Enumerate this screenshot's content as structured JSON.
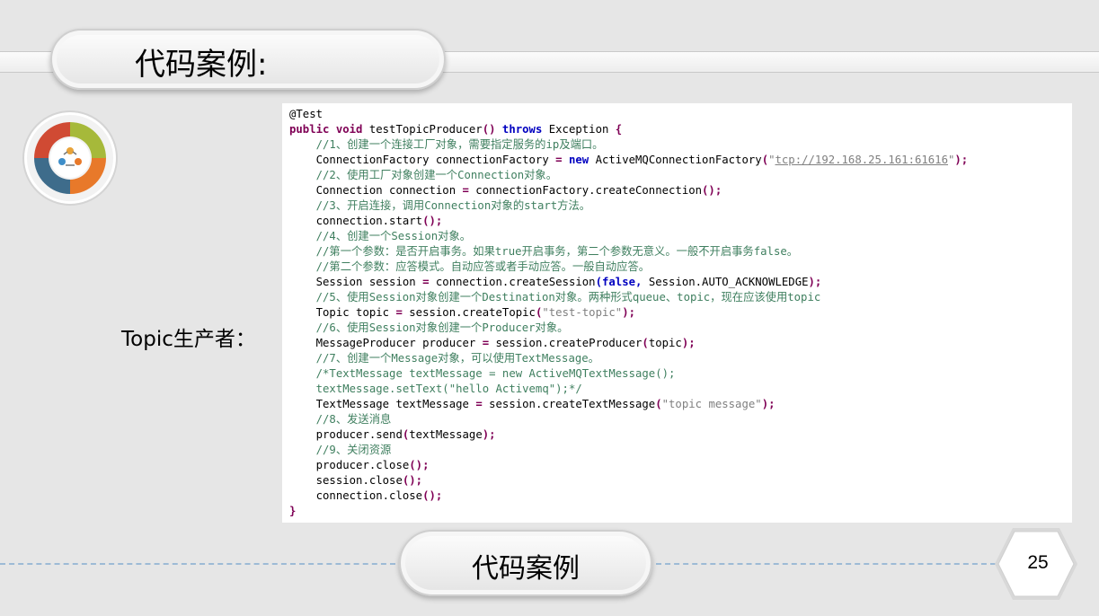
{
  "slide": {
    "title": "代码案例:",
    "side_label": "Topic生产者：",
    "footer_title": "代码案例",
    "page_number": "25"
  },
  "code_lines": [
    {
      "indent": "",
      "segs": [
        {
          "t": "@Test",
          "c": "plain"
        }
      ]
    },
    {
      "indent": "",
      "segs": [
        {
          "t": "public void",
          "c": "kw"
        },
        {
          "t": " testTopicProducer",
          "c": "plain"
        },
        {
          "t": "()",
          "c": "kw"
        },
        {
          "t": " ",
          "c": "plain"
        },
        {
          "t": "throws",
          "c": "kwb"
        },
        {
          "t": " Exception ",
          "c": "plain"
        },
        {
          "t": "{",
          "c": "kw"
        }
      ]
    },
    {
      "indent": "    ",
      "segs": [
        {
          "t": "//1、创建一个连接工厂对象，需要指定服务的ip及端口。",
          "c": "cm"
        }
      ]
    },
    {
      "indent": "    ",
      "segs": [
        {
          "t": "ConnectionFactory connectionFactory ",
          "c": "plain"
        },
        {
          "t": "=",
          "c": "kw"
        },
        {
          "t": " ",
          "c": "plain"
        },
        {
          "t": "new",
          "c": "kwb"
        },
        {
          "t": " ActiveMQConnectionFactory",
          "c": "plain"
        },
        {
          "t": "(",
          "c": "kw"
        },
        {
          "t": "\"",
          "c": "strg"
        },
        {
          "t": "tcp://192.168.25.161:61616",
          "c": "lnk"
        },
        {
          "t": "\"",
          "c": "strg"
        },
        {
          "t": ");",
          "c": "kw"
        }
      ]
    },
    {
      "indent": "    ",
      "segs": [
        {
          "t": "//2、使用工厂对象创建一个Connection对象。",
          "c": "cm"
        }
      ]
    },
    {
      "indent": "    ",
      "segs": [
        {
          "t": "Connection connection ",
          "c": "plain"
        },
        {
          "t": "=",
          "c": "kw"
        },
        {
          "t": " connectionFactory.createConnection",
          "c": "plain"
        },
        {
          "t": "();",
          "c": "kw"
        }
      ]
    },
    {
      "indent": "    ",
      "segs": [
        {
          "t": "//3、开启连接，调用Connection对象的start方法。",
          "c": "cm"
        }
      ]
    },
    {
      "indent": "    ",
      "segs": [
        {
          "t": "connection.start",
          "c": "plain"
        },
        {
          "t": "();",
          "c": "kw"
        }
      ]
    },
    {
      "indent": "    ",
      "segs": [
        {
          "t": "//4、创建一个Session对象。",
          "c": "cm"
        }
      ]
    },
    {
      "indent": "    ",
      "segs": [
        {
          "t": "//第一个参数：是否开启事务。如果true开启事务，第二个参数无意义。一般不开启事务false。",
          "c": "cm"
        }
      ]
    },
    {
      "indent": "    ",
      "segs": [
        {
          "t": "//第二个参数：应答模式。自动应答或者手动应答。一般自动应答。",
          "c": "cm"
        }
      ]
    },
    {
      "indent": "    ",
      "segs": [
        {
          "t": "Session session ",
          "c": "plain"
        },
        {
          "t": "=",
          "c": "kw"
        },
        {
          "t": " connection.createSession",
          "c": "plain"
        },
        {
          "t": "(false,",
          "c": "kwb"
        },
        {
          "t": " Session.AUTO_ACKNOWLEDGE",
          "c": "plain"
        },
        {
          "t": ");",
          "c": "kw"
        }
      ]
    },
    {
      "indent": "    ",
      "segs": [
        {
          "t": "//5、使用Session对象创建一个Destination对象。两种形式queue、topic，现在应该使用topic",
          "c": "cm"
        }
      ]
    },
    {
      "indent": "    ",
      "segs": [
        {
          "t": "Topic topic ",
          "c": "plain"
        },
        {
          "t": "=",
          "c": "kw"
        },
        {
          "t": " session.createTopic",
          "c": "plain"
        },
        {
          "t": "(",
          "c": "kw"
        },
        {
          "t": "\"test-topic\"",
          "c": "strg"
        },
        {
          "t": ");",
          "c": "kw"
        }
      ]
    },
    {
      "indent": "    ",
      "segs": [
        {
          "t": "//6、使用Session对象创建一个Producer对象。",
          "c": "cm"
        }
      ]
    },
    {
      "indent": "    ",
      "segs": [
        {
          "t": "MessageProducer producer ",
          "c": "plain"
        },
        {
          "t": "=",
          "c": "kw"
        },
        {
          "t": " session.createProducer",
          "c": "plain"
        },
        {
          "t": "(",
          "c": "kw"
        },
        {
          "t": "topic",
          "c": "plain"
        },
        {
          "t": ");",
          "c": "kw"
        }
      ]
    },
    {
      "indent": "    ",
      "segs": [
        {
          "t": "//7、创建一个Message对象，可以使用TextMessage。",
          "c": "cm"
        }
      ]
    },
    {
      "indent": "    ",
      "segs": [
        {
          "t": "/*TextMessage textMessage = new ActiveMQTextMessage();",
          "c": "cm"
        }
      ]
    },
    {
      "indent": "    ",
      "segs": [
        {
          "t": "textMessage.setText(\"hello Activemq\");*/",
          "c": "cm"
        }
      ]
    },
    {
      "indent": "    ",
      "segs": [
        {
          "t": "TextMessage textMessage ",
          "c": "plain"
        },
        {
          "t": "=",
          "c": "kw"
        },
        {
          "t": " session.createTextMessage",
          "c": "plain"
        },
        {
          "t": "(",
          "c": "kw"
        },
        {
          "t": "\"topic message\"",
          "c": "strg"
        },
        {
          "t": ");",
          "c": "kw"
        }
      ]
    },
    {
      "indent": "    ",
      "segs": [
        {
          "t": "//8、发送消息",
          "c": "cm"
        }
      ]
    },
    {
      "indent": "    ",
      "segs": [
        {
          "t": "producer.send",
          "c": "plain"
        },
        {
          "t": "(",
          "c": "kw"
        },
        {
          "t": "textMessage",
          "c": "plain"
        },
        {
          "t": ");",
          "c": "kw"
        }
      ]
    },
    {
      "indent": "    ",
      "segs": [
        {
          "t": "//9、关闭资源",
          "c": "cm"
        }
      ]
    },
    {
      "indent": "    ",
      "segs": [
        {
          "t": "producer.close",
          "c": "plain"
        },
        {
          "t": "();",
          "c": "kw"
        }
      ]
    },
    {
      "indent": "    ",
      "segs": [
        {
          "t": "session.close",
          "c": "plain"
        },
        {
          "t": "();",
          "c": "kw"
        }
      ]
    },
    {
      "indent": "    ",
      "segs": [
        {
          "t": "connection.close",
          "c": "plain"
        },
        {
          "t": "();",
          "c": "kw"
        }
      ]
    },
    {
      "indent": "",
      "segs": [
        {
          "t": "}",
          "c": "kw"
        }
      ]
    }
  ],
  "colors": {
    "background": "#e6e6e6",
    "comment": "#3f7f5f",
    "keyword": "#7f0055",
    "keyword_blue": "#0000c0",
    "string": "#808080",
    "dash_line": "#9dbbd6"
  },
  "icons": {
    "logo": "circular-arrows-people-icon",
    "page_badge": "hexagon-badge-icon"
  }
}
